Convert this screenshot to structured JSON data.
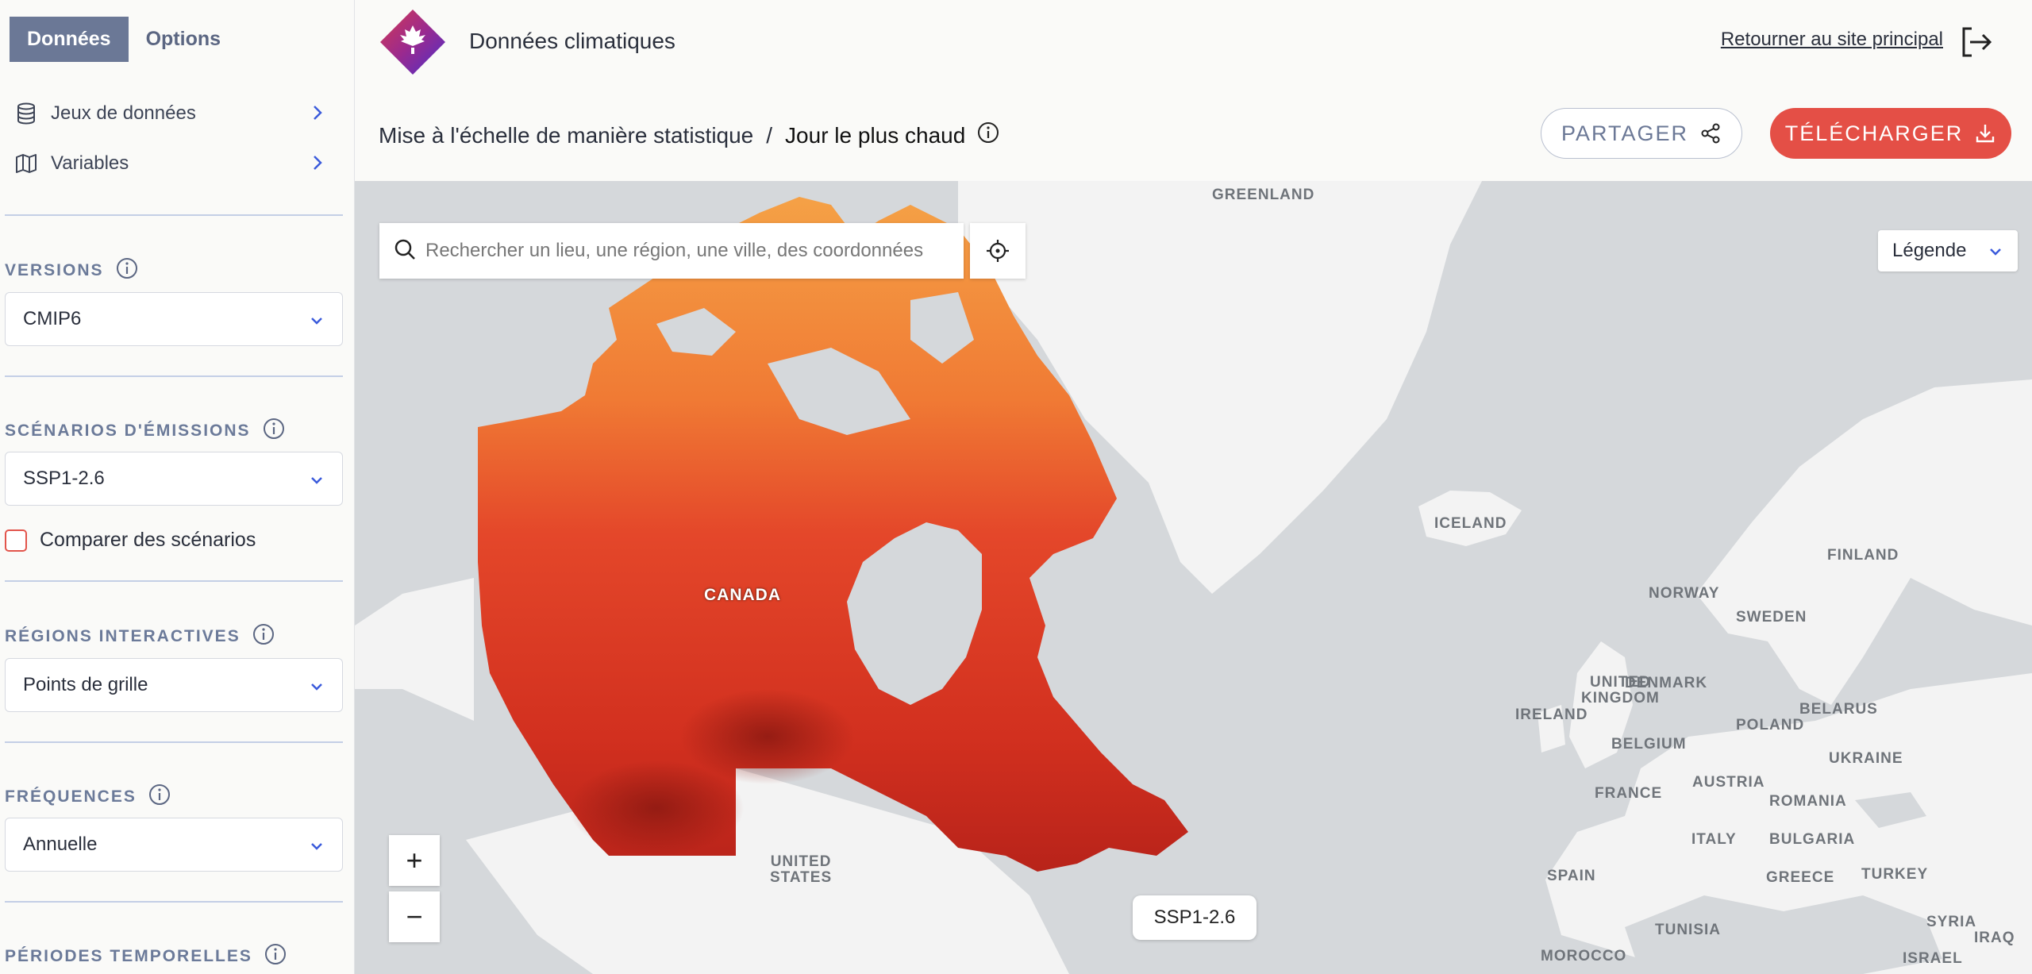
{
  "sidebar": {
    "tabs": [
      {
        "label": "Données",
        "active": true
      },
      {
        "label": "Options",
        "active": false
      }
    ],
    "nav": [
      {
        "label": "Jeux de données",
        "icon": "database-icon"
      },
      {
        "label": "Variables",
        "icon": "map-icon"
      }
    ],
    "versions": {
      "label": "VERSIONS",
      "value": "CMIP6"
    },
    "scenarios": {
      "label": "SCÉNARIOS D'ÉMISSIONS",
      "value": "SSP1-2.6",
      "compare_label": "Comparer des scénarios",
      "compare_checked": false
    },
    "regions": {
      "label": "RÉGIONS INTERACTIVES",
      "value": "Points de grille"
    },
    "frequencies": {
      "label": "FRÉQUENCES",
      "value": "Annuelle"
    },
    "periods": {
      "label": "PÉRIODES TEMPORELLES"
    }
  },
  "header": {
    "app_title": "Données climatiques",
    "return_link": "Retourner au site principal",
    "breadcrumb": {
      "parent": "Mise à l'échelle de manière statistique",
      "separator": "/",
      "current": "Jour le plus chaud"
    },
    "share_label": "PARTAGER",
    "download_label": "TÉLÉCHARGER"
  },
  "map": {
    "search_placeholder": "Rechercher un lieu, une région, une ville, des coordonnées",
    "legend_label": "Légende",
    "zoom_in": "+",
    "zoom_out": "−",
    "scenario_chip": "SSP1-2.6",
    "labels": {
      "greenland": "GREENLAND",
      "canada": "CANADA",
      "iceland": "ICELAND",
      "finland": "FINLAND",
      "norway": "NORWAY",
      "sweden": "SWEDEN",
      "united_kingdom": "UNITED\nKINGDOM",
      "ireland": "IRELAND",
      "denmark": "DENMARK",
      "belarus": "BELARUS",
      "poland": "POLAND",
      "belgium": "BELGIUM",
      "ukraine": "UKRAINE",
      "france": "FRANCE",
      "austria": "AUSTRIA",
      "romania": "ROMANIA",
      "italy": "ITALY",
      "bulgaria": "BULGARIA",
      "spain": "SPAIN",
      "turkey": "TURKEY",
      "greece": "GREECE",
      "syria": "SYRIA",
      "iraq": "IRAQ",
      "tunisia": "TUNISIA",
      "israel": "ISRAEL",
      "morocco": "MOROCCO",
      "united_states": "UNITED\nSTATES"
    },
    "colors": {
      "ocean": "#d5d8db",
      "land": "#f3f3f3",
      "warm_north": "#f5a146",
      "hot_south": "#d8301f",
      "hottest": "#8f1a12"
    }
  }
}
